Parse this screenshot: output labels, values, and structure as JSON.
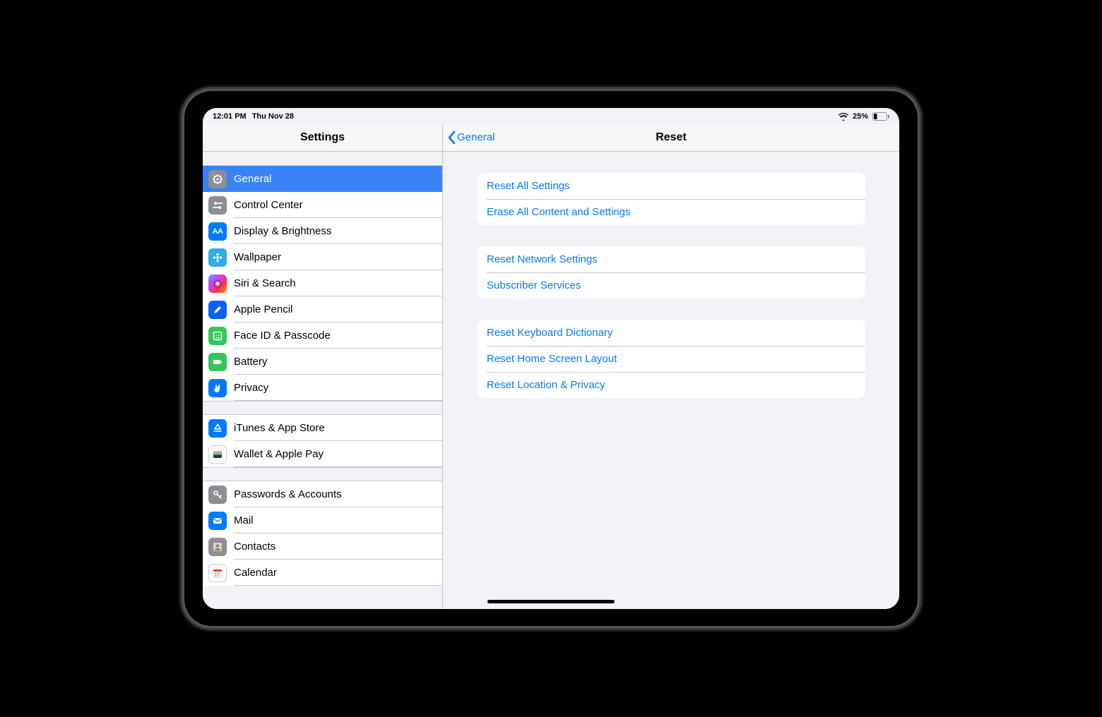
{
  "status": {
    "time": "12:01 PM",
    "date": "Thu Nov 28",
    "battery_pct": "25%"
  },
  "sidebar": {
    "title": "Settings",
    "groups": [
      [
        {
          "id": "general",
          "label": "General",
          "icon": "gear",
          "iconBg": "bg-gray",
          "selected": true
        },
        {
          "id": "control-center",
          "label": "Control Center",
          "icon": "sliders",
          "iconBg": "bg-gray"
        },
        {
          "id": "display",
          "label": "Display & Brightness",
          "icon": "AA",
          "iconBg": "bg-blue"
        },
        {
          "id": "wallpaper",
          "label": "Wallpaper",
          "icon": "flower",
          "iconBg": "bg-cyan"
        },
        {
          "id": "siri",
          "label": "Siri & Search",
          "icon": "siri",
          "iconBg": "bg-siri"
        },
        {
          "id": "pencil",
          "label": "Apple Pencil",
          "icon": "pencil",
          "iconBg": "bg-deepblue"
        },
        {
          "id": "faceid",
          "label": "Face ID & Passcode",
          "icon": "face",
          "iconBg": "bg-green"
        },
        {
          "id": "battery",
          "label": "Battery",
          "icon": "battery",
          "iconBg": "bg-green"
        },
        {
          "id": "privacy",
          "label": "Privacy",
          "icon": "hand",
          "iconBg": "bg-blue"
        }
      ],
      [
        {
          "id": "appstore",
          "label": "iTunes & App Store",
          "icon": "appstore",
          "iconBg": "bg-blue"
        },
        {
          "id": "wallet",
          "label": "Wallet & Apple Pay",
          "icon": "wallet",
          "iconBg": "bg-white"
        }
      ],
      [
        {
          "id": "passwords",
          "label": "Passwords & Accounts",
          "icon": "key",
          "iconBg": "bg-gray"
        },
        {
          "id": "mail",
          "label": "Mail",
          "icon": "mail",
          "iconBg": "bg-blue"
        },
        {
          "id": "contacts",
          "label": "Contacts",
          "icon": "contacts",
          "iconBg": "bg-gray"
        },
        {
          "id": "calendar",
          "label": "Calendar",
          "icon": "calendar",
          "iconBg": "bg-white"
        }
      ]
    ]
  },
  "detail": {
    "back_label": "General",
    "title": "Reset",
    "groups": [
      [
        {
          "id": "reset-all",
          "label": "Reset All Settings"
        },
        {
          "id": "erase-all",
          "label": "Erase All Content and Settings"
        }
      ],
      [
        {
          "id": "reset-network",
          "label": "Reset Network Settings"
        },
        {
          "id": "subscriber",
          "label": "Subscriber Services"
        }
      ],
      [
        {
          "id": "reset-keyboard",
          "label": "Reset Keyboard Dictionary"
        },
        {
          "id": "reset-home",
          "label": "Reset Home Screen Layout"
        },
        {
          "id": "reset-location",
          "label": "Reset Location & Privacy"
        }
      ]
    ]
  }
}
